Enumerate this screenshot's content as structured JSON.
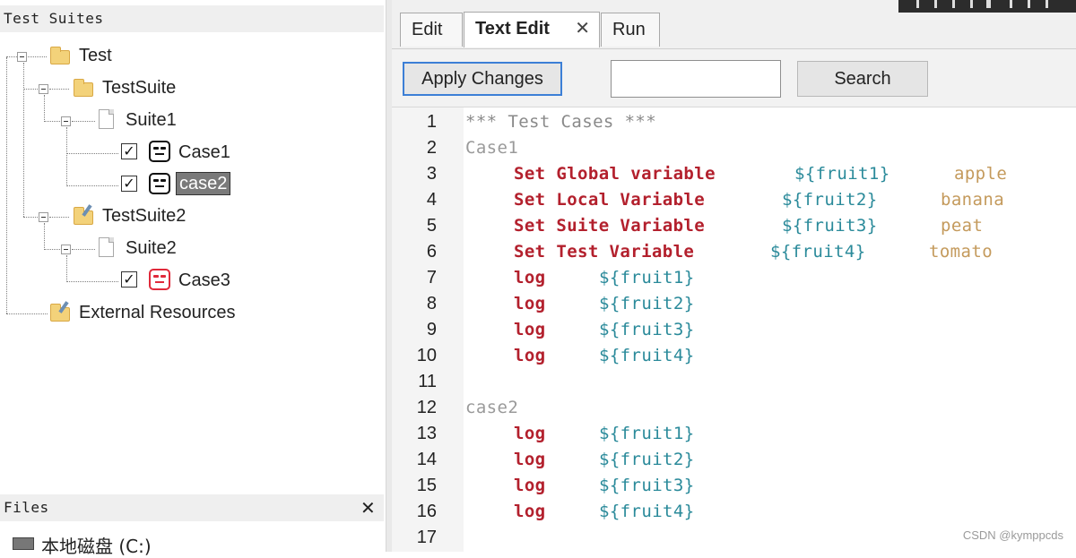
{
  "test_suites_panel": {
    "title": "Test Suites",
    "tree": {
      "root": "Test",
      "suite1_folder": "TestSuite",
      "suite1_file": "Suite1",
      "case1": "Case1",
      "case2": "case2",
      "suite2_folder": "TestSuite2",
      "suite2_file": "Suite2",
      "case3": "Case3",
      "external": "External Resources"
    }
  },
  "files_panel": {
    "title": "Files",
    "close": "✕",
    "drive": "本地磁盘 (C:)"
  },
  "tabs": [
    {
      "label": "Edit"
    },
    {
      "label": "Text Edit",
      "active": true,
      "close": "✕"
    },
    {
      "label": "Run"
    }
  ],
  "toolbar": {
    "apply_label": "Apply Changes",
    "search_value": "",
    "search_label": "Search"
  },
  "editor": {
    "line_numbers": [
      "1",
      "2",
      "3",
      "4",
      "5",
      "6",
      "7",
      "8",
      "9",
      "10",
      "11",
      "12",
      "13",
      "14",
      "15",
      "16",
      "17"
    ],
    "lines": {
      "l1": "*** Test Cases ***",
      "l2": "Case1",
      "l3_kw": "Set Global variable",
      "l3_var": "${fruit1}",
      "l3_arg": "apple",
      "l4_kw": "Set Local Variable",
      "l4_var": "${fruit2}",
      "l4_arg": "banana",
      "l5_kw": "Set Suite Variable",
      "l5_var": "${fruit3}",
      "l5_arg": "peat",
      "l6_kw": "Set Test Variable",
      "l6_var": "${fruit4}",
      "l6_arg": "tomato",
      "log": "log",
      "v1": "${fruit1}",
      "v2": "${fruit2}",
      "v3": "${fruit3}",
      "v4": "${fruit4}",
      "l12": "case2"
    }
  },
  "watermark": "CSDN @kymppcds",
  "colors": {
    "keyword": "#b3202d",
    "variable": "#2a8a9a",
    "argument": "#c49a5c",
    "header": "#8a8a8a",
    "selection_accent": "#3c7fd6",
    "fail_robot": "#e0293a"
  }
}
